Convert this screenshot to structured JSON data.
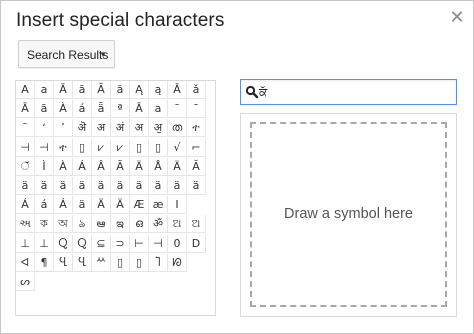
{
  "dialog": {
    "title": "Insert special characters",
    "close_glyph": "✕"
  },
  "category_dropdown": {
    "label": "Search Results",
    "caret": "▼"
  },
  "search": {
    "value": "ਕੱ",
    "icon": "search-icon"
  },
  "draw": {
    "label": "Draw a symbol here"
  },
  "characters": [
    [
      "A",
      "a",
      "Ā",
      "ā",
      "Ă",
      "ă",
      "Ą",
      "ą",
      "Ǎ",
      "ǎ"
    ],
    [
      "Ā",
      "ā",
      "À",
      "á",
      "ǟ",
      "ª",
      "Ā",
      "a",
      "ˉ",
      "ˉ"
    ],
    [
      "ˉ",
      "ʻ",
      "ʼ",
      "ऄ",
      "अ",
      "अं",
      "अ",
      "ॶ",
      "ത",
      "ተ"
    ],
    [
      "⊣",
      "⊣",
      "ተ",
      "▯",
      "⩗",
      "⩗",
      "▯",
      "▯",
      "√",
      "⌐"
    ],
    [
      "ੱ",
      "Ì",
      "À",
      "Á",
      "Â",
      "Ã",
      "Ä",
      "Å",
      "Ä",
      "Ă"
    ],
    [
      "ä",
      "ä",
      "ä",
      "ä",
      "ä",
      "ä",
      "ä",
      "ä",
      "ä",
      "ä"
    ],
    [
      "Á",
      "á",
      "Á",
      "ä",
      "Ä",
      "Ä",
      "Æ",
      "æ",
      "Ⅰ"
    ],
    [
      "અ",
      "ক",
      "অ",
      "ঌ",
      "ఆ",
      "ఇ",
      "ഒ",
      "ॐ",
      "ଅ",
      "ଅ"
    ],
    [
      "⊥",
      "⊥",
      "Ⴍ",
      "Ⴍ",
      "⊆",
      "⊃",
      "⊢",
      "⊣",
      "0",
      "D"
    ],
    [
      "ᐊ",
      "¶",
      "Ⴁ",
      "Ⴁ",
      "ᄊ",
      "▯",
      "▯",
      "Ⴈ",
      "ᘗ"
    ],
    [
      "ᔕ"
    ]
  ]
}
